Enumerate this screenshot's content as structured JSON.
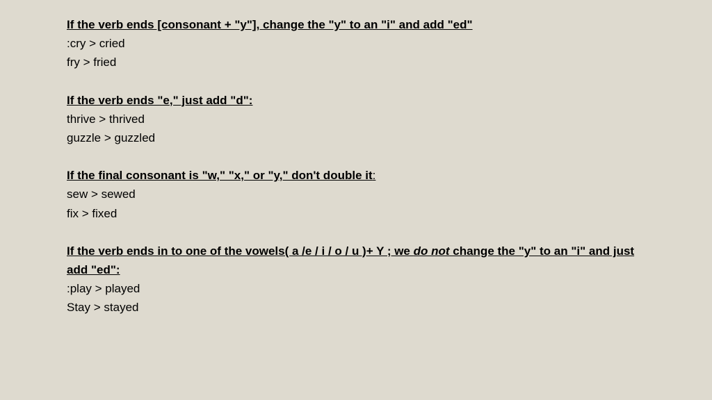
{
  "rules": [
    {
      "heading": "If the verb ends [consonant + \"y\"], change the \"y\" to an \"i\" and add \"ed\"",
      "tail": "",
      "examples": [
        ":cry > cried",
        "fry > fried"
      ]
    },
    {
      "heading": "If the verb ends \"e,\" just add \"d\":",
      "tail": "",
      "examples": [
        "thrive > thrived",
        "guzzle > guzzled"
      ]
    },
    {
      "heading": "If the final consonant is \"w,\" \"x,\" or \"y,\" don't double it",
      "tail": ":",
      "examples": [
        "sew > sewed",
        "fix > fixed"
      ]
    },
    {
      "heading_pre": "If the verb ends in to one of the vowels( a /e / i / o / u )+ Y ; we ",
      "heading_italic": "do not",
      "heading_post": " change the \"y\" to an \"i\" and just add \"ed\":",
      "tail": "",
      "examples": [
        ":play > played",
        "Stay > stayed"
      ]
    }
  ]
}
